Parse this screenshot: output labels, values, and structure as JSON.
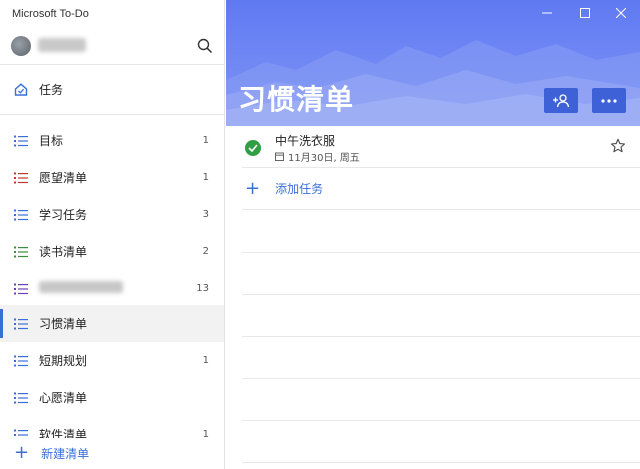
{
  "app": {
    "title": "Microsoft To-Do"
  },
  "user": {
    "name": ""
  },
  "sidebar": {
    "items": [
      {
        "label": "任务",
        "count": "",
        "icon": "home-icon",
        "color": "#3a6fd8"
      },
      {
        "label": "目标",
        "count": "1",
        "icon": "list-icon",
        "color": "#3a6fd8"
      },
      {
        "label": "愿望清单",
        "count": "1",
        "icon": "list-icon",
        "color": "#c0392b"
      },
      {
        "label": "学习任务",
        "count": "3",
        "icon": "list-icon",
        "color": "#3a6fd8"
      },
      {
        "label": "读书清单",
        "count": "2",
        "icon": "list-icon",
        "color": "#3d8b3d"
      },
      {
        "label": "",
        "count": "13",
        "icon": "list-icon",
        "color": "#6a3fb5"
      },
      {
        "label": "习惯清单",
        "count": "",
        "icon": "list-icon",
        "color": "#3a6fd8"
      },
      {
        "label": "短期规划",
        "count": "1",
        "icon": "list-icon",
        "color": "#3a6fd8"
      },
      {
        "label": "心愿清单",
        "count": "",
        "icon": "list-icon",
        "color": "#3a6fd8"
      },
      {
        "label": "软件清单",
        "count": "1",
        "icon": "list-icon",
        "color": "#3a6fd8"
      }
    ],
    "new_list_label": "新建清单"
  },
  "main": {
    "title": "习惯清单",
    "accent": "#6a80f2",
    "tasks": [
      {
        "title": "中午洗衣服",
        "due": "11月30日, 周五",
        "completed": true,
        "starred": false
      }
    ],
    "add_task_label": "添加任务"
  }
}
